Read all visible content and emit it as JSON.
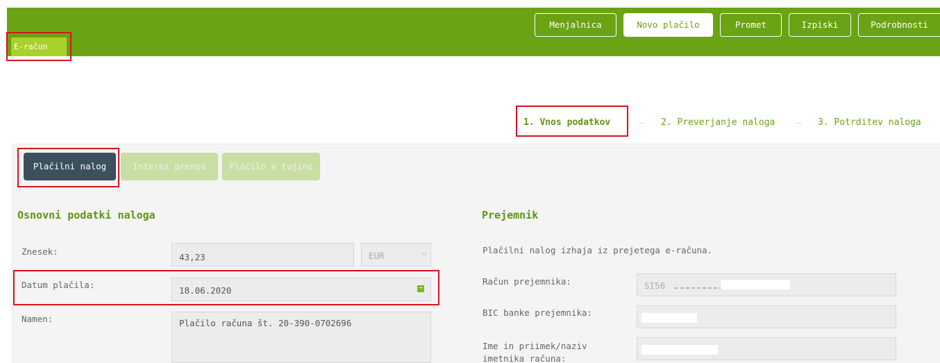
{
  "nav": {
    "items": [
      {
        "label": "Menjalnica"
      },
      {
        "label": "Novo plačilo",
        "active": true
      },
      {
        "label": "Promet"
      },
      {
        "label": "Izpiski"
      },
      {
        "label": "Podrobnosti"
      }
    ],
    "e_racun_tab": "E-račun"
  },
  "steps": [
    {
      "label": "1. Vnos podatkov",
      "active": true
    },
    {
      "label": "2. Preverjanje naloga"
    },
    {
      "label": "3. Potrditev naloga"
    }
  ],
  "tabs": [
    {
      "label": "Plačilni nalog",
      "active": true
    },
    {
      "label": "Interni prenos"
    },
    {
      "label": "Plačilo v tujino"
    }
  ],
  "left": {
    "title": "Osnovni podatki naloga",
    "amount_label": "Znesek:",
    "amount_value": "43,23",
    "currency_value": "EUR",
    "date_label": "Datum plačila:",
    "date_value": "18.06.2020",
    "purpose_label": "Namen:",
    "purpose_value": "Plačilo računa št. 20-390-0702696"
  },
  "right": {
    "title": "Prejemnik",
    "info": "Plačilni nalog izhaja iz prejetega e-računa.",
    "account_label": "Račun prejemnika:",
    "account_value": "SI56",
    "bic_label": "BIC banke prejemnika:",
    "name_label_line1": "Ime in priimek/naziv",
    "name_label_line2": "imetnika računa:"
  },
  "colors": {
    "brand_green": "#6aa313",
    "highlight_red": "#d4151b",
    "active_tab": "#3c4f5c"
  }
}
